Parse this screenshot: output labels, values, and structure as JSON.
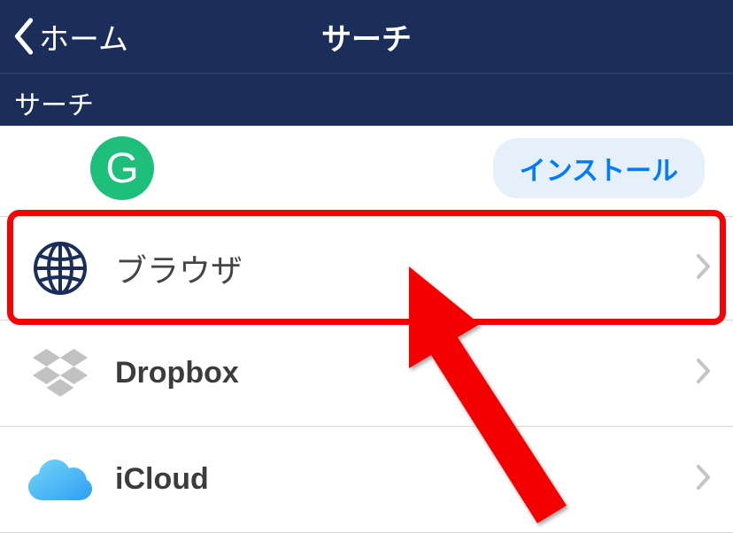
{
  "nav": {
    "back_label": "ホーム",
    "title": "サーチ"
  },
  "section": {
    "label": "サーチ"
  },
  "ad": {
    "icon_letter": "G",
    "install_label": "インストール"
  },
  "items": [
    {
      "label": "ブラウザ"
    },
    {
      "label": "Dropbox"
    },
    {
      "label": "iCloud"
    }
  ]
}
